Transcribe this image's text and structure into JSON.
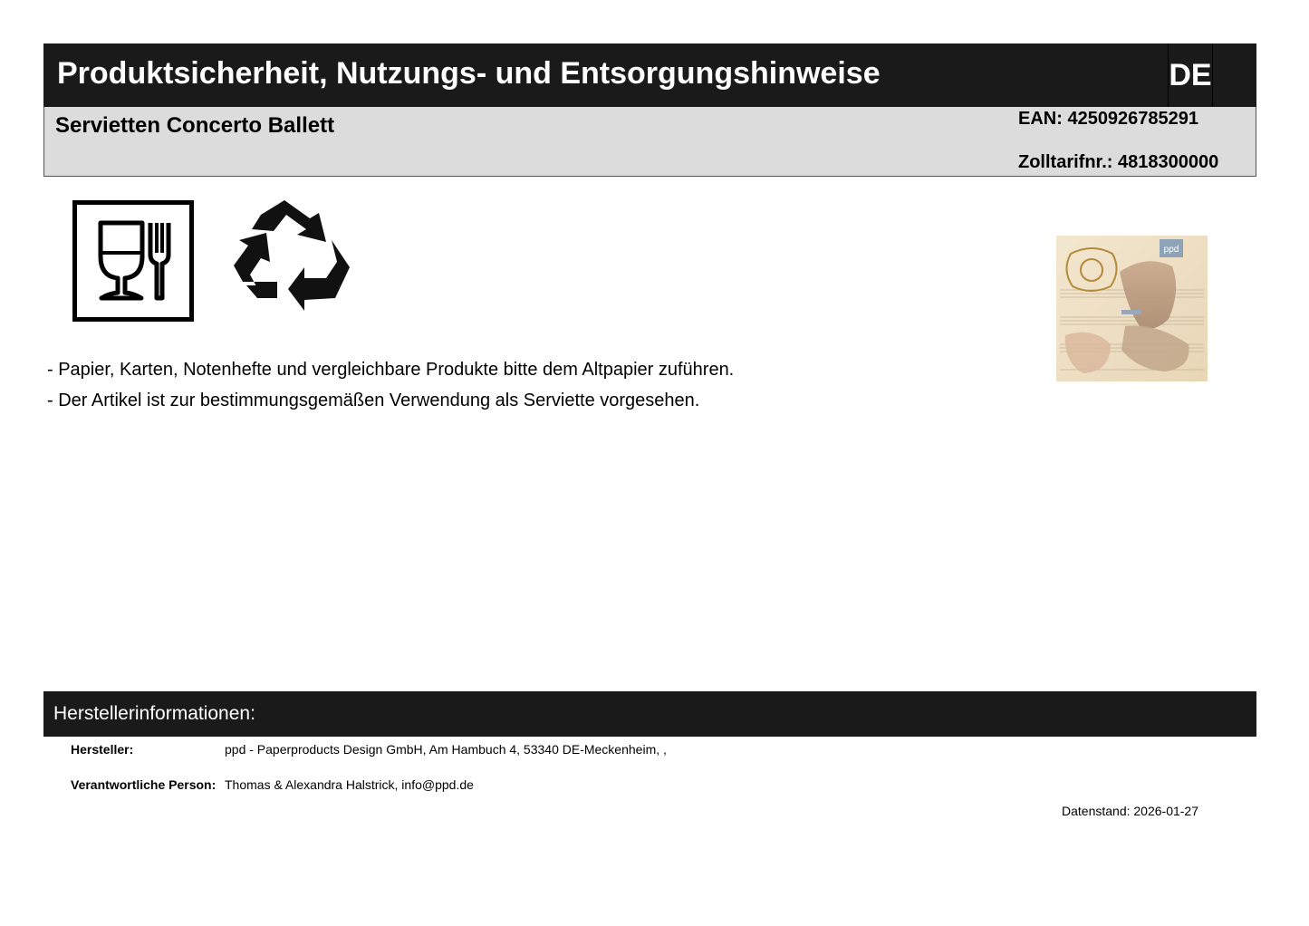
{
  "header": {
    "title": "Produktsicherheit, Nutzungs- und Entsorgungshinweise",
    "language": "DE"
  },
  "product": {
    "name": "Servietten Concerto Ballett",
    "ean": "EAN: 4250926785291",
    "customs_tariff": "Zolltarifnr.: 4818300000",
    "image_label": "ppd"
  },
  "icons": [
    "food-safe-icon",
    "recycle-icon"
  ],
  "notes": [
    "- Papier, Karten, Notenhefte und vergleichbare Produkte bitte dem Altpapier zuführen.",
    "- Der Artikel ist zur bestimmungsgemäßen Verwendung als Serviette vorgesehen."
  ],
  "manufacturer": {
    "section_title": "Herstellerinformationen:",
    "maker_label": "Hersteller:",
    "maker_value": "ppd - Paperproducts Design GmbH, Am Hambuch 4, 53340 DE-Meckenheim, ,",
    "person_label": "Verantwortliche Person:",
    "person_value": "Thomas & Alexandra Halstrick, info@ppd.de"
  },
  "date_stamp": "Datenstand: 2026-01-27",
  "colors": {
    "header_bg": "#1a1a1a",
    "product_bar_bg": "#dcdcdc"
  }
}
